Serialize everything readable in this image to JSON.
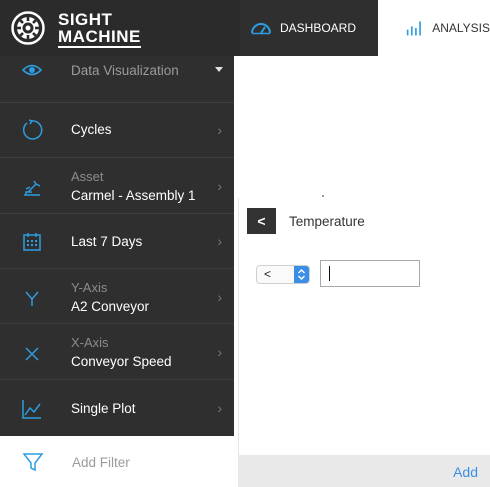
{
  "brand": {
    "line1": "SIGHT",
    "line2": "MACHINE"
  },
  "nav": {
    "dashboard": {
      "label": "DASHBOARD",
      "icon": "gauge-icon"
    },
    "analysis": {
      "label": "ANALYSIS",
      "icon": "bar-chart-icon"
    }
  },
  "sidebar": {
    "menu": {
      "label": "Data Visualization",
      "icon": "eye-icon"
    },
    "items": [
      {
        "label": "Cycles",
        "sublabel": "",
        "icon": "cycle-icon"
      },
      {
        "label": "Carmel - Assembly 1",
        "sublabel": "Asset",
        "icon": "robot-arm-icon"
      },
      {
        "label": "Last 7 Days",
        "sublabel": "",
        "icon": "calendar-icon"
      },
      {
        "label": "A2 Conveyor",
        "sublabel": "Y-Axis",
        "icon": "y-axis-icon"
      },
      {
        "label": "Conveyor Speed",
        "sublabel": "X-Axis",
        "icon": "x-axis-icon"
      },
      {
        "label": "Single Plot",
        "sublabel": "",
        "icon": "line-chart-icon"
      }
    ],
    "add_filter": {
      "label": "Add Filter",
      "icon": "funnel-icon"
    }
  },
  "panel": {
    "back_label": "<",
    "title": "Temperature",
    "operator": "<",
    "value": "",
    "add_label": "Add"
  },
  "colors": {
    "accent": "#2d9de0",
    "sidebar_bg": "#2f2f2f",
    "link": "#3b8ee8"
  }
}
